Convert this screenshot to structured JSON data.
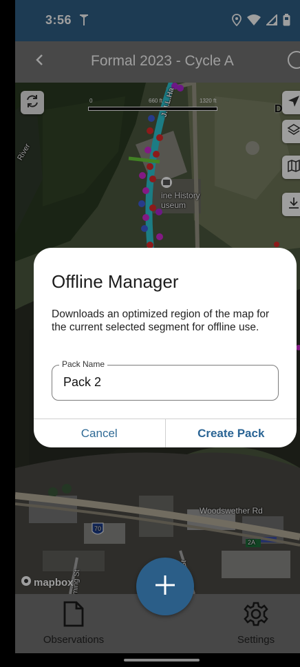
{
  "status_bar": {
    "time": "3:56",
    "icons": [
      "antenna-icon",
      "location-icon",
      "wifi-icon",
      "signal-icon",
      "battery-icon"
    ]
  },
  "header": {
    "title": "Formal 2023 - Cycle A",
    "back_icon": "chevron-left-icon",
    "info_icon": "info-icon"
  },
  "map": {
    "scale_labels": [
      "0",
      "660 ft",
      "1320 ft"
    ],
    "labels": {
      "river": "River",
      "museum_line1": "ine History",
      "museum_line2": "useum",
      "road_partial": "J.H.L.Ha",
      "street_d": "D",
      "interstate": "70",
      "woodswether": "Woodswether Rd",
      "exit": "2A",
      "st_left": "ming St",
      "st_right": "cy St"
    },
    "logo": "mapbox",
    "controls": [
      "refresh-icon",
      "navigation-arrow-icon",
      "layers-icon",
      "map-icon",
      "download-icon"
    ],
    "colors": {
      "route": "#2ec8d6",
      "point_purple": "#b026d8",
      "point_red": "#e22b2b",
      "point_blue": "#3f5fe0",
      "point_green": "#6ad13a",
      "point_magenta": "#d42ad6"
    }
  },
  "dialog": {
    "title": "Offline Manager",
    "body": "Downloads an optimized region of the map for the current selected segment for offline use.",
    "field_label": "Pack Name",
    "field_value": "Pack 2",
    "cancel_label": "Cancel",
    "create_label": "Create Pack"
  },
  "tabs": {
    "observations_label": "Observations",
    "settings_label": "Settings"
  },
  "fab": {
    "icon": "plus-icon"
  },
  "colors": {
    "status_bar": "#2f5f86",
    "header": "#747474",
    "accent": "#2a6494"
  }
}
